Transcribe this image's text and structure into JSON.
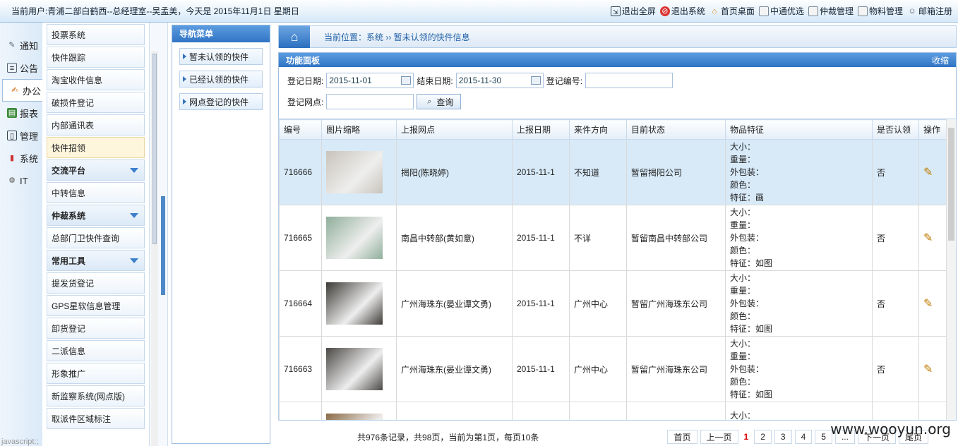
{
  "topbar": {
    "user_info": "当前用户:青浦二部白鹤西--总经理室--吴孟美，今天是 2015年11月1日 星期日",
    "links": [
      "退出全屏",
      "退出系统",
      "首页桌面",
      "中通优选",
      "仲裁管理",
      "物料管理",
      "邮箱注册"
    ]
  },
  "left_tabs": [
    "通知",
    "公告",
    "办公",
    "报表",
    "管理",
    "系统",
    "IT"
  ],
  "menu": [
    {
      "label": "投票系统",
      "type": "item"
    },
    {
      "label": "快件跟踪",
      "type": "item"
    },
    {
      "label": "淘宝收件信息",
      "type": "item"
    },
    {
      "label": "破损件登记",
      "type": "item"
    },
    {
      "label": "内部通讯表",
      "type": "item"
    },
    {
      "label": "快件招领",
      "type": "sel"
    },
    {
      "label": "交流平台",
      "type": "sec"
    },
    {
      "label": "中转信息",
      "type": "item"
    },
    {
      "label": "仲裁系统",
      "type": "sec"
    },
    {
      "label": "总部门卫快件查询",
      "type": "item"
    },
    {
      "label": "常用工具",
      "type": "sec"
    },
    {
      "label": "提发货登记",
      "type": "item"
    },
    {
      "label": "GPS星软信息管理",
      "type": "item"
    },
    {
      "label": "卸货登记",
      "type": "item"
    },
    {
      "label": "二派信息",
      "type": "item"
    },
    {
      "label": "形象推广",
      "type": "item"
    },
    {
      "label": "新监察系统(网点版)",
      "type": "item"
    },
    {
      "label": "取派件区域标注",
      "type": "item"
    }
  ],
  "nav": {
    "title": "导航菜单",
    "items": [
      "暂未认领的快件",
      "已经认领的快件",
      "网点登记的快件"
    ]
  },
  "crumb": "当前位置：系统 ›› 暂未认领的快件信息",
  "panel": {
    "title": "功能面板",
    "collapse": "收缩",
    "reg_date_label": "登记日期:",
    "reg_date_value": "2015-11-01",
    "end_date_label": "结束日期:",
    "end_date_value": "2015-11-30",
    "reg_no_label": "登记编号:",
    "reg_site_label": "登记网点:",
    "search_button": "查询"
  },
  "table": {
    "headers": [
      "编号",
      "图片缩略",
      "上报网点",
      "上报日期",
      "来件方向",
      "目前状态",
      "物品特征",
      "是否认领",
      "操作"
    ],
    "feature_labels": [
      "大小：",
      "重量：",
      "外包装：",
      "颜色："
    ],
    "rows": [
      {
        "id": "716666",
        "site": "揭阳(陈晓婷)",
        "date": "2015-11-1",
        "direction": "不知道",
        "status": "暂留揭阳公司",
        "feature": "特征：画",
        "claimed": "否",
        "img": "#c9c4bb"
      },
      {
        "id": "716665",
        "site": "南昌中转部(黄如意)",
        "date": "2015-11-1",
        "direction": "不详",
        "status": "暂留南昌中转部公司",
        "feature": "特征：如图",
        "claimed": "否",
        "img": "#8fae9a"
      },
      {
        "id": "716664",
        "site": "广州海珠东(晏业谭文勇)",
        "date": "2015-11-1",
        "direction": "广州中心",
        "status": "暂留广州海珠东公司",
        "feature": "特征：如图",
        "claimed": "否",
        "img": "#3d3a36"
      },
      {
        "id": "716663",
        "site": "广州海珠东(晏业谭文勇)",
        "date": "2015-11-1",
        "direction": "广州中心",
        "status": "暂留广州海珠东公司",
        "feature": "特征：如图",
        "claimed": "否",
        "img": "#4a4845"
      },
      {
        "id": "",
        "site": "",
        "date": "",
        "direction": "",
        "status": "",
        "feature": "",
        "claimed": "",
        "img": "#8a6a45"
      }
    ]
  },
  "pager": {
    "info": "共976条记录，共98页，当前为第1页，每页10条",
    "first": "首页",
    "prev": "上一页",
    "pages": [
      "1",
      "2",
      "3",
      "4",
      "5",
      "..."
    ],
    "next": "下一页",
    "last": "尾页"
  },
  "watermark": "www.wooyun.org",
  "status_bar": "javascript:;"
}
